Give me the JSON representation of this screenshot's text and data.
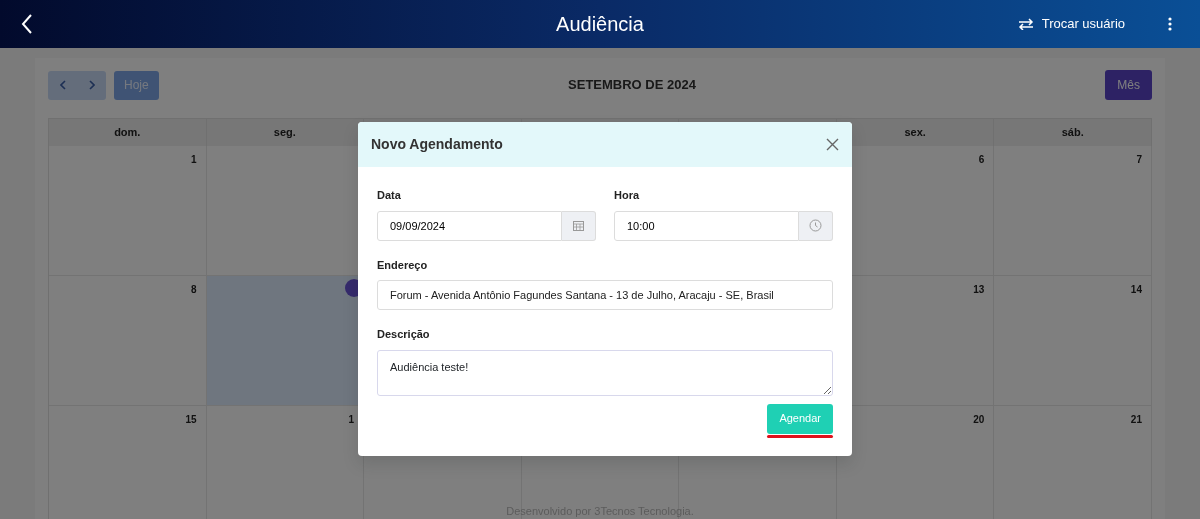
{
  "header": {
    "title": "Audiência",
    "switch_user": "Trocar usuário"
  },
  "calendar": {
    "title": "SETEMBRO DE 2024",
    "today_button": "Hoje",
    "view_buttons": [
      {
        "label": "Mês",
        "selected": true
      }
    ],
    "weekdays_left": [
      "dom.",
      "seg."
    ],
    "weekdays_right": [
      "sex.",
      "sáb."
    ],
    "weeks": [
      {
        "left": [
          {
            "day": "1",
            "today": false
          },
          {
            "today": false
          }
        ],
        "right": [
          {
            "day": "6",
            "today": false
          },
          {
            "day": "7",
            "today": false
          }
        ]
      },
      {
        "left": [
          {
            "day": "8",
            "today": false
          },
          {
            "today": true,
            "has_event": true
          }
        ],
        "right": [
          {
            "day": "13",
            "today": false
          },
          {
            "day": "14",
            "today": false
          }
        ]
      },
      {
        "left": [
          {
            "day": "15",
            "today": false
          },
          {
            "day": "1",
            "today": false
          }
        ],
        "right": [
          {
            "day": "20",
            "today": false
          },
          {
            "day": "21",
            "today": false
          }
        ]
      }
    ]
  },
  "modal": {
    "title": "Novo Agendamento",
    "fields": [
      {
        "kind": "date",
        "label": "Data",
        "value": "09/09/2024"
      },
      {
        "kind": "time",
        "label": "Hora",
        "value": "10:00"
      },
      {
        "kind": "text",
        "label": "Endereço",
        "value": "Forum - Avenida Antônio Fagundes Santana - 13 de Julho, Aracaju - SE, Brasil"
      },
      {
        "kind": "textarea",
        "label": "Descrição",
        "value": "Audiência teste!"
      }
    ],
    "submit": "Agendar",
    "submit_underlined": true
  },
  "footer": "Desenvolvido por 3Tecnos Tecnologia."
}
